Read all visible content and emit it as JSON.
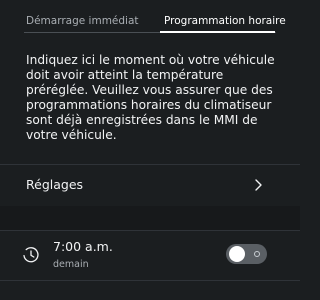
{
  "tabs": {
    "items": [
      {
        "label": "Démarrage immédiat"
      },
      {
        "label": "Programmation horaire"
      }
    ]
  },
  "description": "Indiquez ici le moment où votre véhicule doit avoir atteint la température préréglée. Veuillez vous assurer que des programmations horaires du climatiseur sont déjà enregistrées dans le MMI de votre véhicule.",
  "settings": {
    "label": "Réglages"
  },
  "timer": {
    "time": "7:00 a.m.",
    "day": "demain",
    "enabled": false
  },
  "icons": {
    "clock": "clock-icon",
    "chevron": "chevron-right-icon"
  },
  "colors": {
    "background": "#1b1e20",
    "text": "#f2f3f4",
    "muted": "#a9aeb3",
    "toggle_off": "#5a5f64"
  }
}
